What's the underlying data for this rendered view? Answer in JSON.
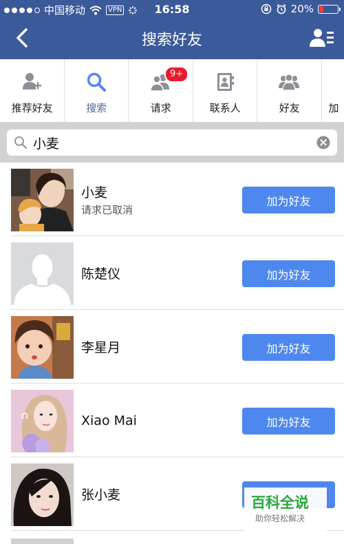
{
  "status_bar": {
    "carrier": "中国移动",
    "vpn": "VPN",
    "time": "16:58",
    "battery": "20%",
    "battery_level": 0.2
  },
  "nav": {
    "title": "搜索好友",
    "back_icon": "chevron-left-icon",
    "contacts_icon": "person-list-icon"
  },
  "tabs": [
    {
      "label": "推荐好友",
      "icon": "person-add-icon",
      "active": false
    },
    {
      "label": "搜索",
      "icon": "search-icon",
      "active": true
    },
    {
      "label": "请求",
      "icon": "people-icon",
      "badge": "9+",
      "active": false
    },
    {
      "label": "联系人",
      "icon": "contacts-book-icon",
      "active": false
    },
    {
      "label": "好友",
      "icon": "group-icon",
      "active": false
    },
    {
      "label": "加",
      "icon": "",
      "active": false
    }
  ],
  "search": {
    "value": "小麦",
    "placeholder": ""
  },
  "results": [
    {
      "name": "小麦",
      "status": "请求已取消",
      "button": "加为好友",
      "avatar": "photo"
    },
    {
      "name": "陈楚仪",
      "status": "",
      "button": "加为好友",
      "avatar": "default"
    },
    {
      "name": "李星月",
      "status": "",
      "button": "加为好友",
      "avatar": "photo"
    },
    {
      "name": "Xiao Mai",
      "status": "",
      "button": "加为好友",
      "avatar": "photo"
    },
    {
      "name": "张小麦",
      "status": "",
      "button": "加为好友",
      "avatar": "photo"
    }
  ],
  "watermark": {
    "title": "百科全说",
    "subtitle": "助你轻松解决"
  },
  "colors": {
    "nav_bg": "#3b5a9a",
    "accent": "#4e88ef",
    "badge": "#e81c2a",
    "active_tab": "#4e69a2"
  }
}
